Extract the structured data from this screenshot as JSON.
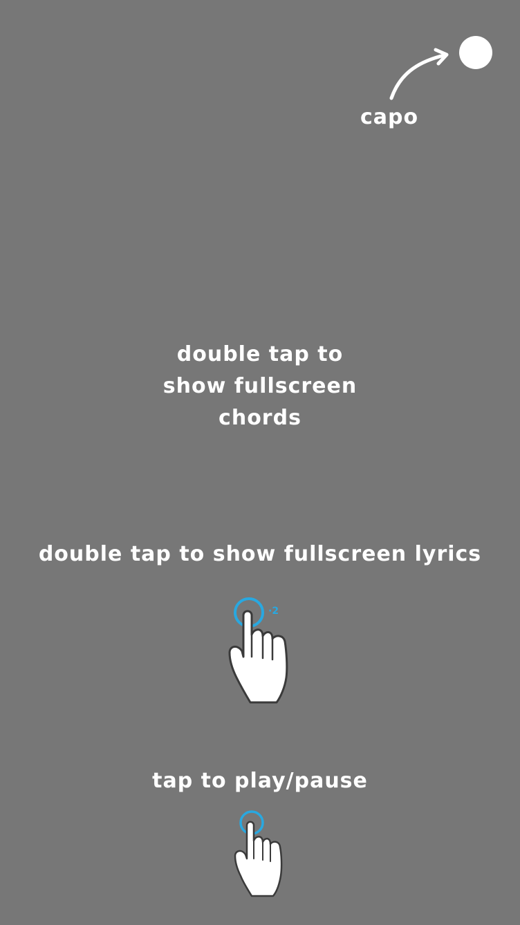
{
  "capo": {
    "label": "capo"
  },
  "hints": {
    "chords_line1": "double tap to",
    "chords_line2": "show fullscreen",
    "chords_line3": "chords",
    "lyrics": "double tap to show fullscreen lyrics",
    "play": "tap to play/pause"
  },
  "gestures": {
    "double_tap_count": "·2"
  },
  "colors": {
    "background": "#777777",
    "text": "#ffffff",
    "tap_ring": "#29a8e0"
  }
}
